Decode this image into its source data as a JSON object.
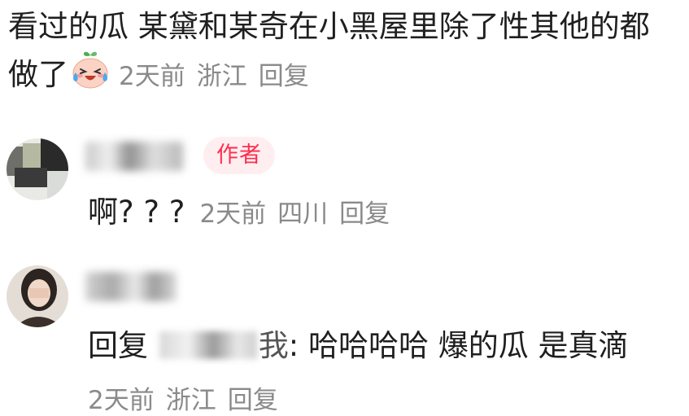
{
  "top_comment": {
    "text": "看过的瓜 某黛和某奇在小黑屋里除了性其他的都做了",
    "emoji": "crying-laughing-face-icon",
    "time": "2天前",
    "location": "浙江",
    "reply_label": "回复"
  },
  "replies": [
    {
      "username": "",
      "badge": "作者",
      "content": "啊? ? ?",
      "time": "2天前",
      "location": "四川",
      "reply_label": "回复"
    },
    {
      "username": "",
      "reply_prefix": "回复",
      "mention_tail": "我",
      "content": ": 哈哈哈哈 爆的瓜 是真滴",
      "time": "2天前",
      "location": "浙江",
      "reply_label": "回复"
    }
  ],
  "colors": {
    "text": "#1f1f1f",
    "meta": "#8a8a8a",
    "badge_text": "#ff2e4d",
    "badge_bg": "#ffeef0"
  }
}
